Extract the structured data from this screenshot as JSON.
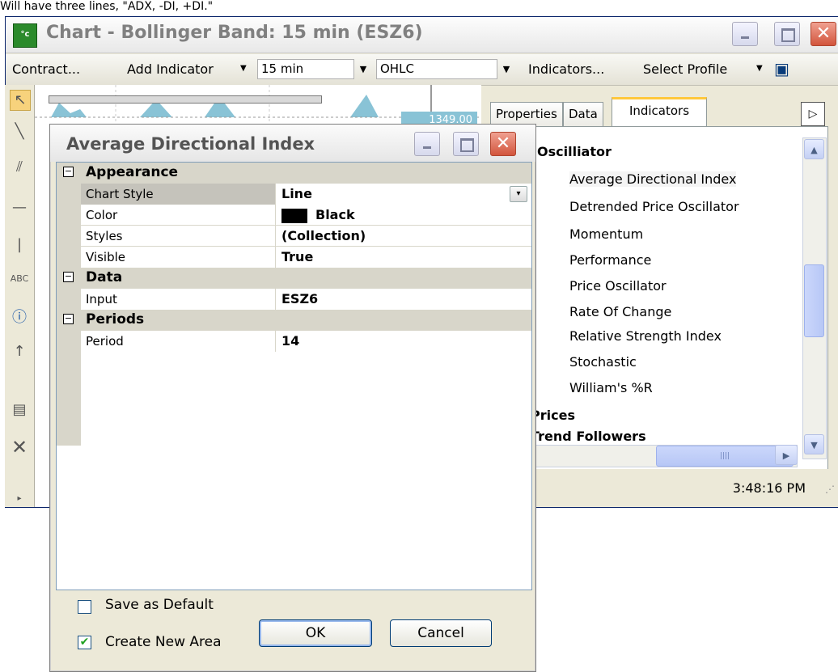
{
  "caption": "Will have three lines, \"ADX, -DI, +DI.\"",
  "window": {
    "title": "Chart - Bollinger Band: 15 min (ESZ6)",
    "icon": "chart-app-icon"
  },
  "toolbar": {
    "contract": "Contract...",
    "add_indicator": "Add Indicator",
    "interval": "15 min",
    "chart_type": "OHLC",
    "indicators": "Indicators...",
    "select_profile": "Select Profile"
  },
  "chart": {
    "price_tag": "1349.00"
  },
  "panel": {
    "tabs": [
      "Properties",
      "Data",
      "Indicators"
    ],
    "active_tab": "Indicators",
    "categories": [
      {
        "label": "Oscilliator",
        "items": [
          "Average Directional Index",
          "Detrended Price Oscillator",
          "Momentum",
          "Performance",
          "Price Oscillator",
          "Rate Of Change",
          "Relative Strength Index",
          "Stochastic",
          "William's %R"
        ]
      },
      {
        "label": "Prices",
        "items": []
      },
      {
        "label": "Trend Followers",
        "items": []
      }
    ],
    "selected_item": "Average Directional Index"
  },
  "status": {
    "time": "3:48:16 PM"
  },
  "dialog": {
    "title": "Average Directional Index",
    "categories": [
      {
        "label": "Appearance",
        "props": [
          {
            "name": "Chart Style",
            "value": "Line"
          },
          {
            "name": "Color",
            "value": "Black"
          },
          {
            "name": "Styles",
            "value": "(Collection)"
          },
          {
            "name": "Visible",
            "value": "True"
          }
        ]
      },
      {
        "label": "Data",
        "props": [
          {
            "name": "Input",
            "value": "ESZ6"
          }
        ]
      },
      {
        "label": "Periods",
        "props": [
          {
            "name": "Period",
            "value": "14"
          }
        ]
      }
    ],
    "save_default": {
      "label": "Save as Default",
      "checked": false
    },
    "create_area": {
      "label": "Create New Area",
      "checked": true
    },
    "ok": "OK",
    "cancel": "Cancel"
  },
  "colors": {
    "accent_tab": "#ffc83c",
    "close_button": "#d2553c",
    "chart_fill": "#89c3d6"
  }
}
